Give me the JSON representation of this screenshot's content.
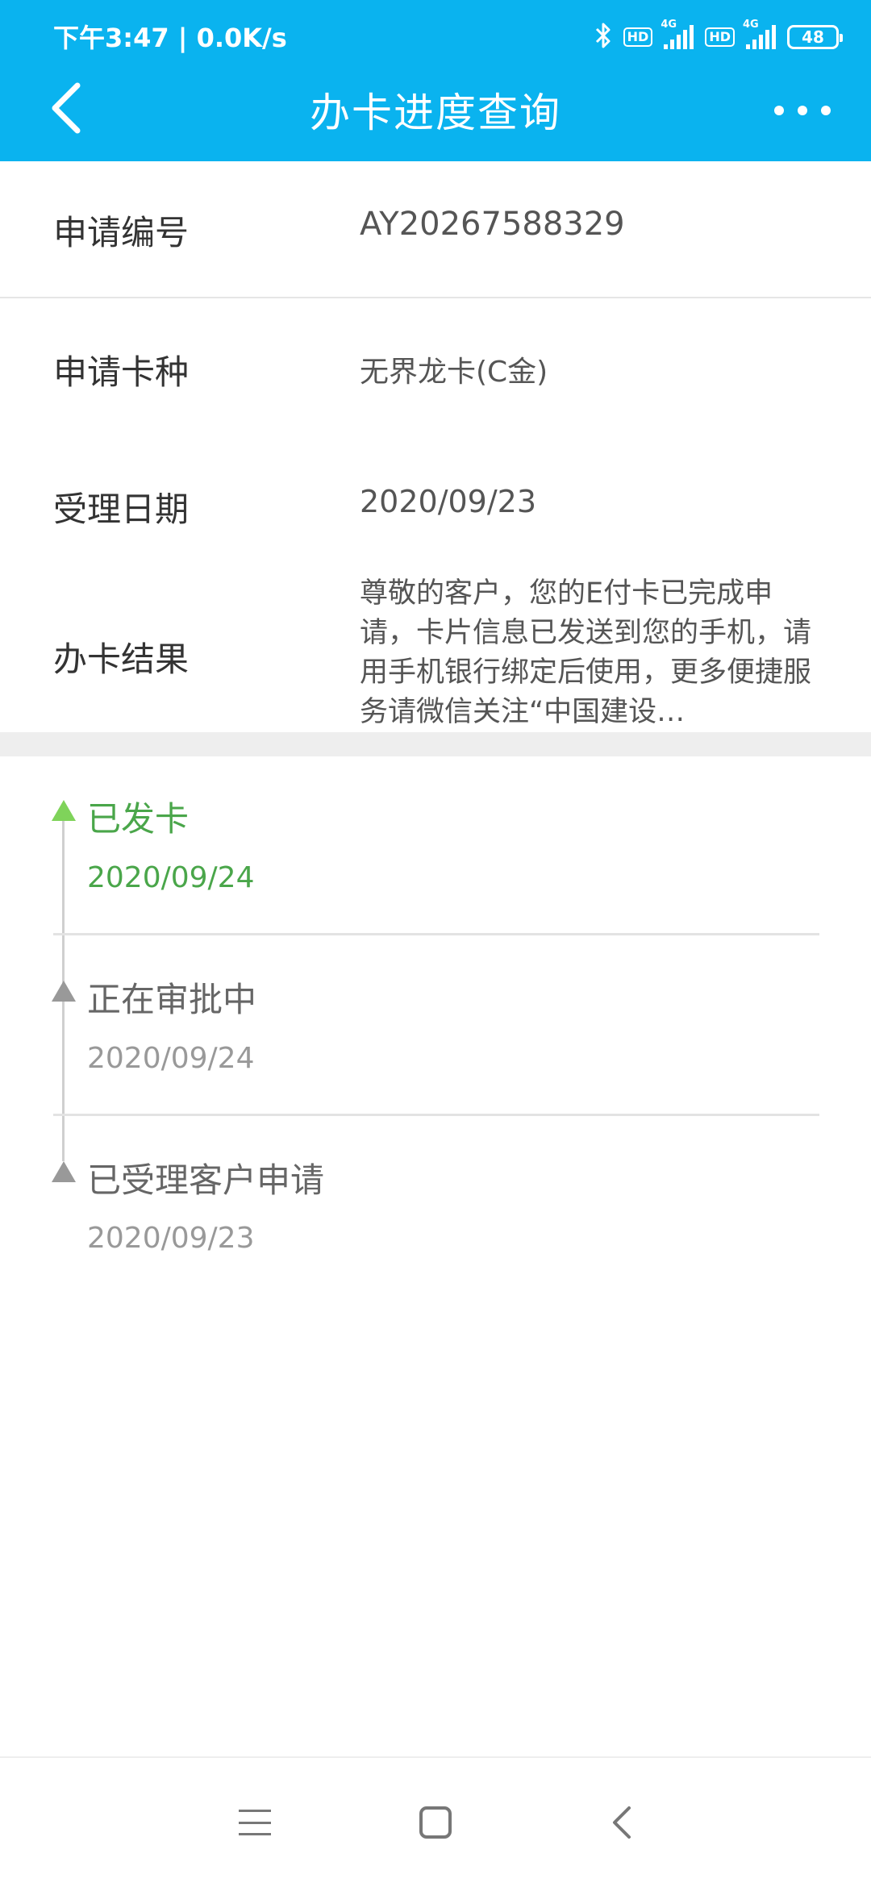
{
  "status_bar": {
    "time": "下午3:47 | 0.0K/s",
    "battery": "48",
    "hd_label": "HD",
    "network_label": "4G"
  },
  "header": {
    "title": "办卡进度查询"
  },
  "info": {
    "application_number_label": "申请编号",
    "application_number": "AY20267588329",
    "card_type_label": "申请卡种",
    "card_type": "无界龙卡(C金)",
    "accept_date_label": "受理日期",
    "accept_date": "2020/09/23",
    "result_label": "办卡结果",
    "result_text": "尊敬的客户，您的E付卡已完成申请，卡片信息已发送到您的手机，请用手机银行绑定后使用，更多便捷服务请微信关注“中国建设…"
  },
  "timeline": [
    {
      "title": "已发卡",
      "date": "2020/09/24",
      "active": true
    },
    {
      "title": "正在审批中",
      "date": "2020/09/24",
      "active": false
    },
    {
      "title": "已受理客户申请",
      "date": "2020/09/23",
      "active": false
    }
  ],
  "colors": {
    "header_bg": "#0ab3ef",
    "active_green": "#4aa64a",
    "active_triangle": "#7fd35a"
  }
}
